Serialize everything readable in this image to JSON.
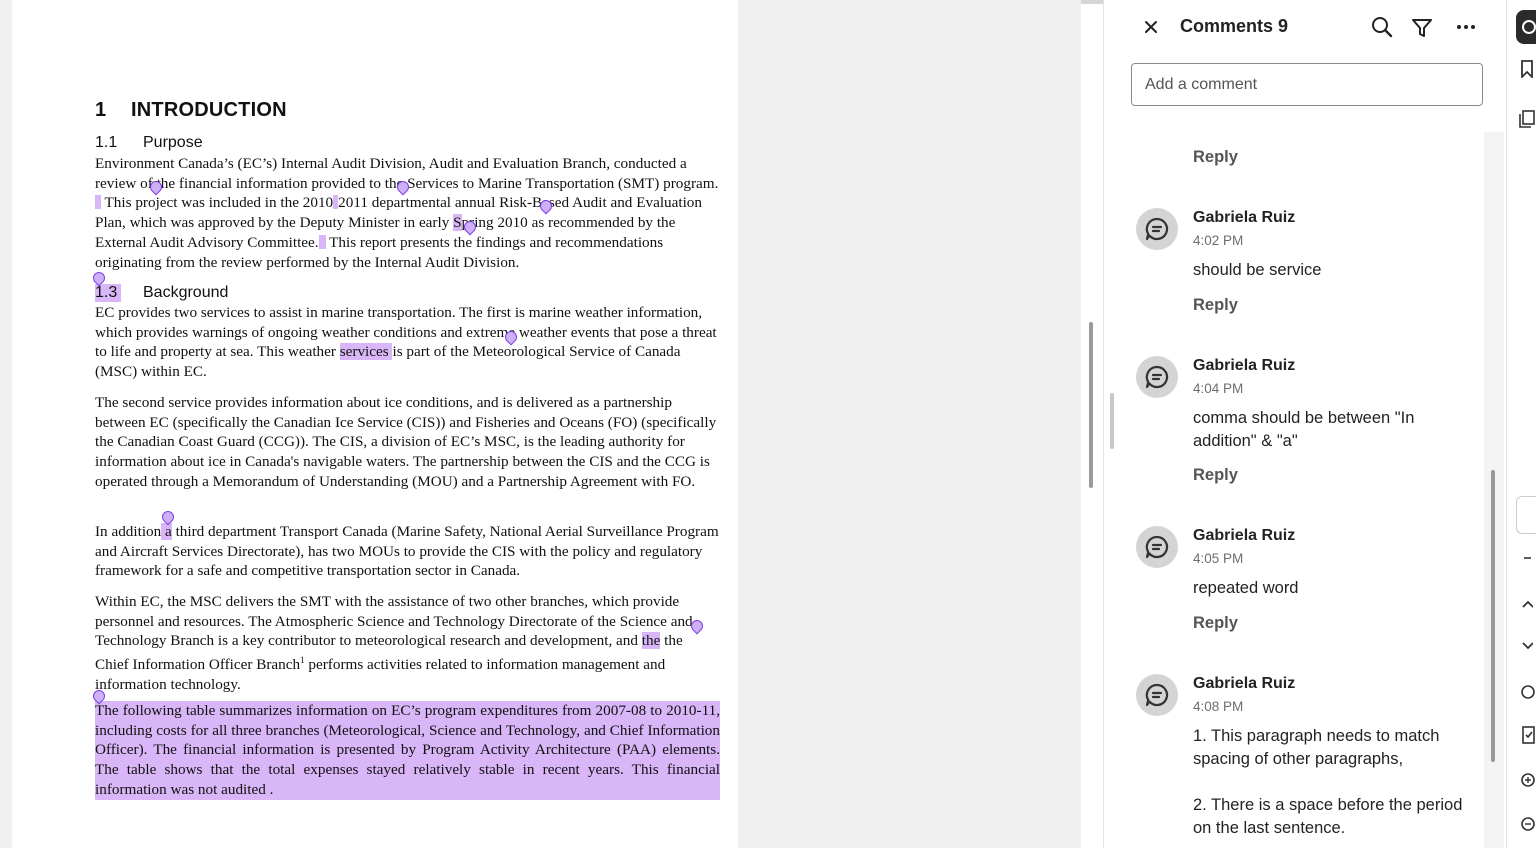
{
  "document": {
    "h1": {
      "num": "1",
      "text": "INTRODUCTION"
    },
    "purpose": {
      "num": "1.1",
      "title": "Purpose",
      "text_a": "Environment Canada’s (EC’s) Internal Audit Division, Audit and Evaluation Branch, conducted a review of the financial information provided to the Services to Marine Transportation (SMT) program.",
      "text_b": " This project was included in the 2010",
      "text_c": "2011 departmental annual Risk-Based Audit and Evaluation Plan, which was approved by the Deputy Minister in early ",
      "text_d": "S",
      "text_e": "pring 2010 as recommended by the External Audit Advisory Committee.",
      "text_f": " This report presents the findings and recommendations originating from the review performed by the Internal Audit Division."
    },
    "background": {
      "num": "1.3",
      "title": "Background",
      "p1_a": "EC provides two services to assist in marine transportation. The first is marine weather information, which provides warnings of ongoing weather conditions and extreme weather events that pose a threat to life and property at sea. This weather ",
      "p1_hl": "services ",
      "p1_b": "is part of the Meteorological Service of Canada (MSC) within EC.",
      "p2": "The second service provides information about ice conditions, and is delivered as a partnership between EC (specifically the Canadian Ice Service (CIS)) and Fisheries and Oceans (FO) (specifically the Canadian Coast Guard (CCG)). The CIS, a division of EC’s MSC, is the leading authority for information about ice in Canada's navigable waters. The partnership between the CIS and the CCG is operated through a Memorandum of Understanding (MOU) and a Partnership Agreement with FO.",
      "p3_a": "In addition",
      "p3_hl": " a",
      "p3_b": " third department Transport Canada (Marine Safety, National Aerial Surveillance Program and Aircraft Services Directorate), has two MOUs to provide the CIS with the policy and regulatory framework for a safe and competitive transportation sector in Canada.",
      "p4_a": "Within EC, the MSC delivers the SMT with the assistance of two other branches, which provide personnel and resources. The Atmospheric Science and Technology Directorate of the Science and Technology Branch is a key contributor to meteorological research and development, and ",
      "p4_hl": "the",
      "p4_b": " the Chief Information Officer Branch",
      "p4_sup": "1",
      "p4_c": " performs activities related to information management and information technology.",
      "p5": "The following table summarizes information on EC’s program expenditures from 2007-08 to 2010-11, including costs for all three branches (Meteorological, Science and Technology, and Chief Information Officer). The financial information is presented by Program Activity Architecture (PAA) elements. The table shows that the total expenses stayed relatively stable in recent years. This financial information was not audited ."
    }
  },
  "comments_panel": {
    "title": "Comments 9",
    "add_placeholder": "Add a comment",
    "top_reply": "Reply",
    "comments": [
      {
        "author": "Gabriela Ruiz",
        "time": "4:02 PM",
        "text": "should be service",
        "reply": "Reply"
      },
      {
        "author": "Gabriela Ruiz",
        "time": "4:04 PM",
        "text": "comma should be between \"In addition\" & \"a\"",
        "reply": "Reply"
      },
      {
        "author": "Gabriela Ruiz",
        "time": "4:05 PM",
        "text": "repeated word",
        "reply": "Reply"
      },
      {
        "author": "Gabriela Ruiz",
        "time": "4:08 PM",
        "text": "1. This paragraph needs to match spacing of other paragraphs,\n\n2. There is a space before the period on the last sentence."
      }
    ]
  },
  "colors": {
    "highlight": "#d9b6f7",
    "pin": "#7b3fe4",
    "avatar_bg": "#d4d4d4"
  }
}
